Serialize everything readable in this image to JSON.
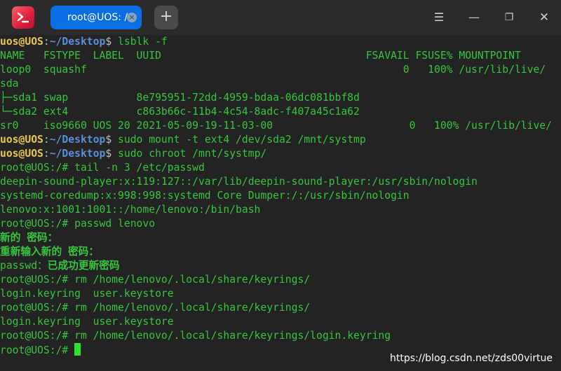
{
  "titlebar": {
    "tab_title": "root@UOS: /",
    "tab_close_glyph": "×",
    "new_tab_glyph": "+",
    "menu_glyph": "☰",
    "minimize_glyph": "—",
    "maximize_glyph": "❐",
    "close_glyph": "✕"
  },
  "colors": {
    "output_green": "#36c53f",
    "user_host_yellow": "#e8c84a",
    "path_blue": "#5b8fd6",
    "tab_blue": "#0a6ee6",
    "background": "#232323"
  },
  "terminal": {
    "prompt_user": "uos@UOS",
    "prompt_colon": ":",
    "prompt_path": "~/Desktop",
    "prompt_sym": "$ ",
    "root_prompt": "root@UOS:/# ",
    "cmd1": "lsblk -f",
    "header": "NAME   FSTYPE  LABEL  UUID                                 FSAVAIL FSUSE% MOUNTPOINT",
    "row_loop0": "loop0  squashf                                                   0   100% /usr/lib/live/",
    "row_sda": "sda",
    "row_sda1": "├─sda1 swap           8e795951-72dd-4959-bdaa-06dc081bbf8d",
    "row_sda2": "└─sda2 ext4           c863b66c-11b4-4c54-8adc-f407a45c1a62",
    "row_sr0": "sr0    iso9660 UOS 20 2021-05-09-19-11-03-00                      0   100% /usr/lib/live/",
    "cmd2": "sudo mount -t ext4 /dev/sda2 /mnt/systmp",
    "cmd3": "sudo chroot /mnt/systmp/",
    "cmd4": "tail -n 3 /etc/passwd",
    "out4_1": "deepin-sound-player:x:119:127::/var/lib/deepin-sound-player:/usr/sbin/nologin",
    "out4_2": "systemd-coredump:x:998:998:systemd Core Dumper:/:/usr/sbin/nologin",
    "out4_3": "lenovo:x:1001:1001::/home/lenovo:/bin/bash",
    "cmd5": "passwd lenovo",
    "pw_new": "新的 密码：",
    "pw_retype": "重新输入新的 密码：",
    "pw_done_prefix": "passwd：",
    "pw_done": "已成功更新密码",
    "cmd6": "rm /home/lenovo/.local/share/keyrings/",
    "out6": "login.keyring  user.keystore",
    "cmd7": "rm /home/lenovo/.local/share/keyrings/",
    "out7": "login.keyring  user.keystore",
    "cmd8": "rm /home/lenovo/.local/share/keyrings/login.keyring"
  },
  "watermark": "https://blog.csdn.net/zds00virtue"
}
